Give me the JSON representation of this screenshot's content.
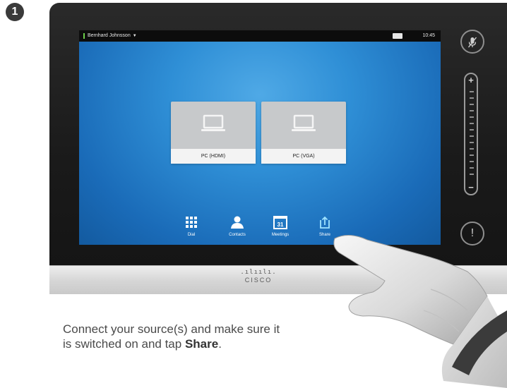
{
  "step": {
    "number": "1"
  },
  "status_bar": {
    "user": "Bernhard Johnsson",
    "caret": "▼",
    "time": "10:45"
  },
  "sources": [
    {
      "label": "PC (HDMI)"
    },
    {
      "label": "PC (VGA)"
    }
  ],
  "bottom_bar": {
    "items": [
      {
        "label": "Dial",
        "icon": "dial-keypad-icon"
      },
      {
        "label": "Contacts",
        "icon": "person-icon"
      },
      {
        "label": "Meetings",
        "icon": "calendar-icon",
        "day": "31"
      },
      {
        "label": "Share",
        "icon": "share-icon"
      }
    ]
  },
  "side_controls": {
    "mute_icon": "microphone-muted-icon",
    "volume_plus": "+",
    "volume_minus": "−",
    "alert": "!"
  },
  "brand": {
    "bars": ".ılıılı.",
    "name": "CISCO"
  },
  "instruction": {
    "text_before": "Connect your source(s) and make sure it is switched on and tap ",
    "bold": "Share",
    "text_after": "."
  },
  "colors": {
    "screen_blue": "#2f8fd6",
    "status_green": "#6cd04a",
    "bezel": "#1c1c1c"
  }
}
